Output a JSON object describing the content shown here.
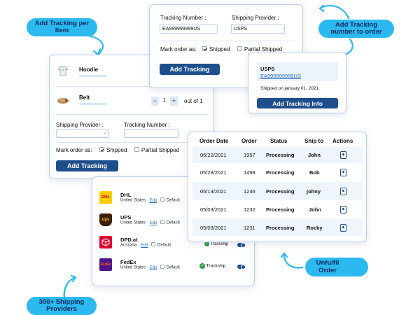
{
  "callouts": {
    "per_item": "Add Tracking per Item",
    "add_to_order": "Add Tracking number to order",
    "unfulfilled": "Unfulfil Order",
    "providers": "300+ Shipping Providers"
  },
  "top_form": {
    "tracking_label": "Tracking Number :",
    "tracking_value": "EA999999999US",
    "provider_label": "Shipping Provider :",
    "provider_value": "USPS",
    "mark_label": "Mark order as:",
    "shipped": "Shipped",
    "partial": "Partial Shipped",
    "button": "Add Tracking"
  },
  "tracking_info": {
    "provider": "USPS",
    "number": "EA999999999US",
    "shipped_on": "Shipped on january 01, 2021",
    "button": "Add Tracking Info"
  },
  "item_form": {
    "items": [
      {
        "name": "Hoodie"
      },
      {
        "name": "Belt",
        "qty_minus": "−",
        "qty": "1",
        "qty_plus": "+",
        "out_of": "out of 1"
      }
    ],
    "provider_label": "Shipping Provider :",
    "tracking_label": "Tracking Number :",
    "mark_label": "Mark order as:",
    "shipped": "Shipped",
    "partial": "Partial Shipped",
    "button": "Add Tracking"
  },
  "providers": {
    "list": [
      {
        "logo": "DHL",
        "name": "DHL",
        "country": "United States",
        "edit": "Edit",
        "default": "Default",
        "color": "#ffcc00",
        "text_color": "#d40511"
      },
      {
        "logo": "ups",
        "name": "UPS",
        "country": "United States",
        "edit": "Edit",
        "default": "Default",
        "color": "#3b1f0c",
        "text_color": "#ffb500"
      },
      {
        "logo": "DPD",
        "name": "DPD.at",
        "country": "Australia",
        "edit": "Edit",
        "default": "Default",
        "color": "#dc0032",
        "text_color": "#ffffff"
      },
      {
        "logo": "FedEx",
        "name": "FedEx",
        "country": "United States",
        "edit": "Edit",
        "default": "Default",
        "color": "#4d148c",
        "text_color": "#ff6600"
      }
    ],
    "trackship_dpd": "Trackship",
    "trackship_fedex": "Trackship"
  },
  "orders": {
    "headers": [
      "Order Date",
      "Order",
      "Status",
      "Ship to",
      "Actions"
    ],
    "rows": [
      {
        "date": "06/22/2021",
        "order": "1957",
        "status": "Processing",
        "ship_to": "John"
      },
      {
        "date": "05/28/2021",
        "order": "1498",
        "status": "Processing",
        "ship_to": "Bob"
      },
      {
        "date": "05/13/2021",
        "order": "1246",
        "status": "Processing",
        "ship_to": "johny"
      },
      {
        "date": "05/03/2021",
        "order": "1232",
        "status": "Processing",
        "ship_to": "John"
      },
      {
        "date": "05/03/2021",
        "order": "1231",
        "status": "Processing",
        "ship_to": "Rocky"
      }
    ]
  },
  "colors": {
    "accent": "#1f4e8c",
    "callout": "#2bb9ef",
    "border": "#b9cdf1"
  }
}
